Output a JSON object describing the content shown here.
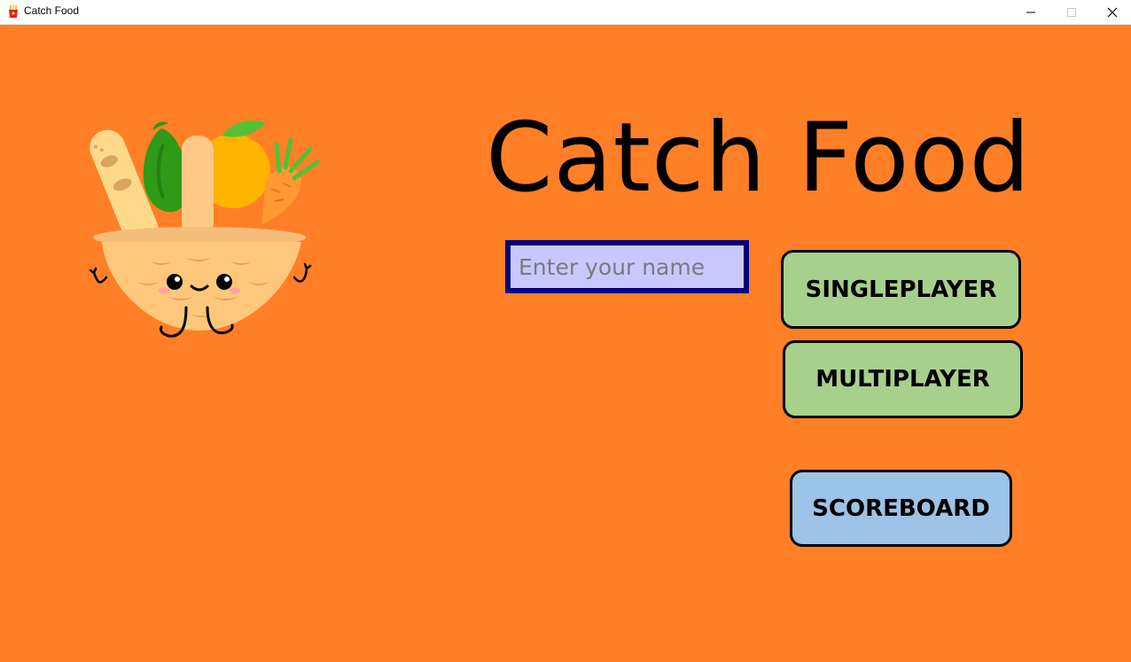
{
  "window": {
    "title": "Catch Food",
    "icon": "fries-icon",
    "controls": [
      "minimize-icon",
      "maximize-icon",
      "close-icon"
    ]
  },
  "main": {
    "title": "Catch Food",
    "name_input": {
      "placeholder": "Enter your name",
      "value": ""
    },
    "buttons": {
      "singleplayer": "SINGLEPLAYER",
      "multiplayer": "MULTIPLAYER",
      "scoreboard": "SCOREBOARD"
    },
    "mascot": "food-basket-mascot"
  },
  "colors": {
    "background": "#ff7f27",
    "input_bg": "#c8c8ff",
    "input_border": "#000080",
    "play_buttons": "#a8d08d",
    "scoreboard_button": "#9dc3e6"
  }
}
